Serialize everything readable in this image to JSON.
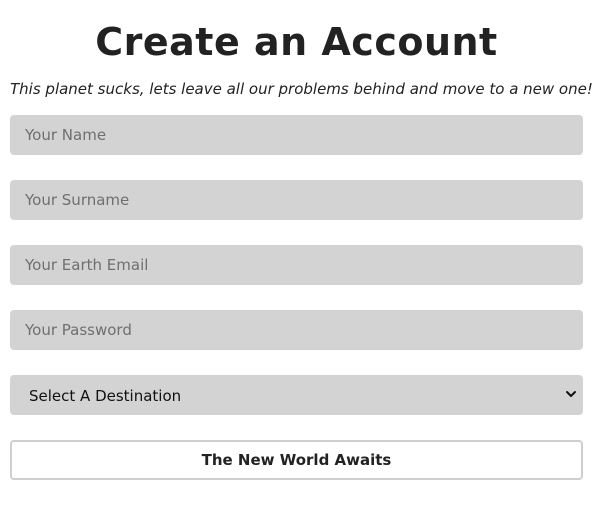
{
  "header": {
    "title": "Create an Account",
    "subtitle": "This planet sucks, lets leave all our problems behind and move to a new one!"
  },
  "form": {
    "name": {
      "placeholder": "Your Name",
      "value": ""
    },
    "surname": {
      "placeholder": "Your Surname",
      "value": ""
    },
    "email": {
      "placeholder": "Your Earth Email",
      "value": ""
    },
    "password": {
      "placeholder": "Your Password",
      "value": ""
    },
    "destination": {
      "selected": "Select A Destination",
      "icon": "chevron-down-icon"
    },
    "submit_label": "The New World Awaits"
  },
  "colors": {
    "field_background": "#d3d3d3",
    "text": "#222222",
    "button_border": "#cfcfcf"
  }
}
